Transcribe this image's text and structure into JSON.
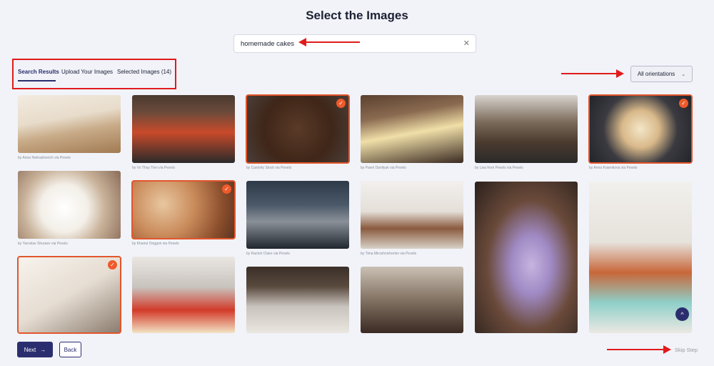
{
  "page": {
    "title": "Select the Images"
  },
  "search": {
    "value": "homemade cakes",
    "clear_icon": "close-icon"
  },
  "tabs": [
    {
      "label": "Search Results",
      "active": true
    },
    {
      "label": "Upload Your Images",
      "active": false
    },
    {
      "label": "Selected Images (14)",
      "active": false
    }
  ],
  "orientation": {
    "selected": "All orientations",
    "icon": "chevron-down-icon"
  },
  "photos": [
    {
      "credit": "by Anna Nekrashevich via Pexels",
      "selected": false
    },
    {
      "credit": "by Vo Thuy Tien via Pexels",
      "selected": false
    },
    {
      "credit": "by Castorly Stock via Pexels",
      "selected": true
    },
    {
      "credit": "by Pavel Danilyuk via Pexels",
      "selected": false
    },
    {
      "credit": "by Lisa from Pexels via Pexels",
      "selected": false
    },
    {
      "credit": "by Anna Kraenkova via Pexels",
      "selected": true
    },
    {
      "credit": "by Yaroslav Shuraev via Pexels",
      "selected": false
    },
    {
      "credit": "by Khairul Onggon via Pexels",
      "selected": true
    },
    {
      "credit": "by Rachel Claire via Pexels",
      "selected": false
    },
    {
      "credit": "by Tima Miroshnichenko via Pexels",
      "selected": false
    },
    {
      "credit": "",
      "selected": false
    },
    {
      "credit": "",
      "selected": false
    },
    {
      "credit": "",
      "selected": true
    },
    {
      "credit": "",
      "selected": false
    },
    {
      "credit": "",
      "selected": false
    },
    {
      "credit": "",
      "selected": false
    }
  ],
  "check_icon": "✓",
  "buttons": {
    "next": "Next",
    "next_icon": "→",
    "back": "Back",
    "skip": "Skip Step"
  },
  "scroll_top_icon": "^",
  "colors": {
    "accent": "#2b2e6e",
    "selected_outline": "#e2562d",
    "annotation": "#e11b1b",
    "background": "#f1f3f9"
  }
}
